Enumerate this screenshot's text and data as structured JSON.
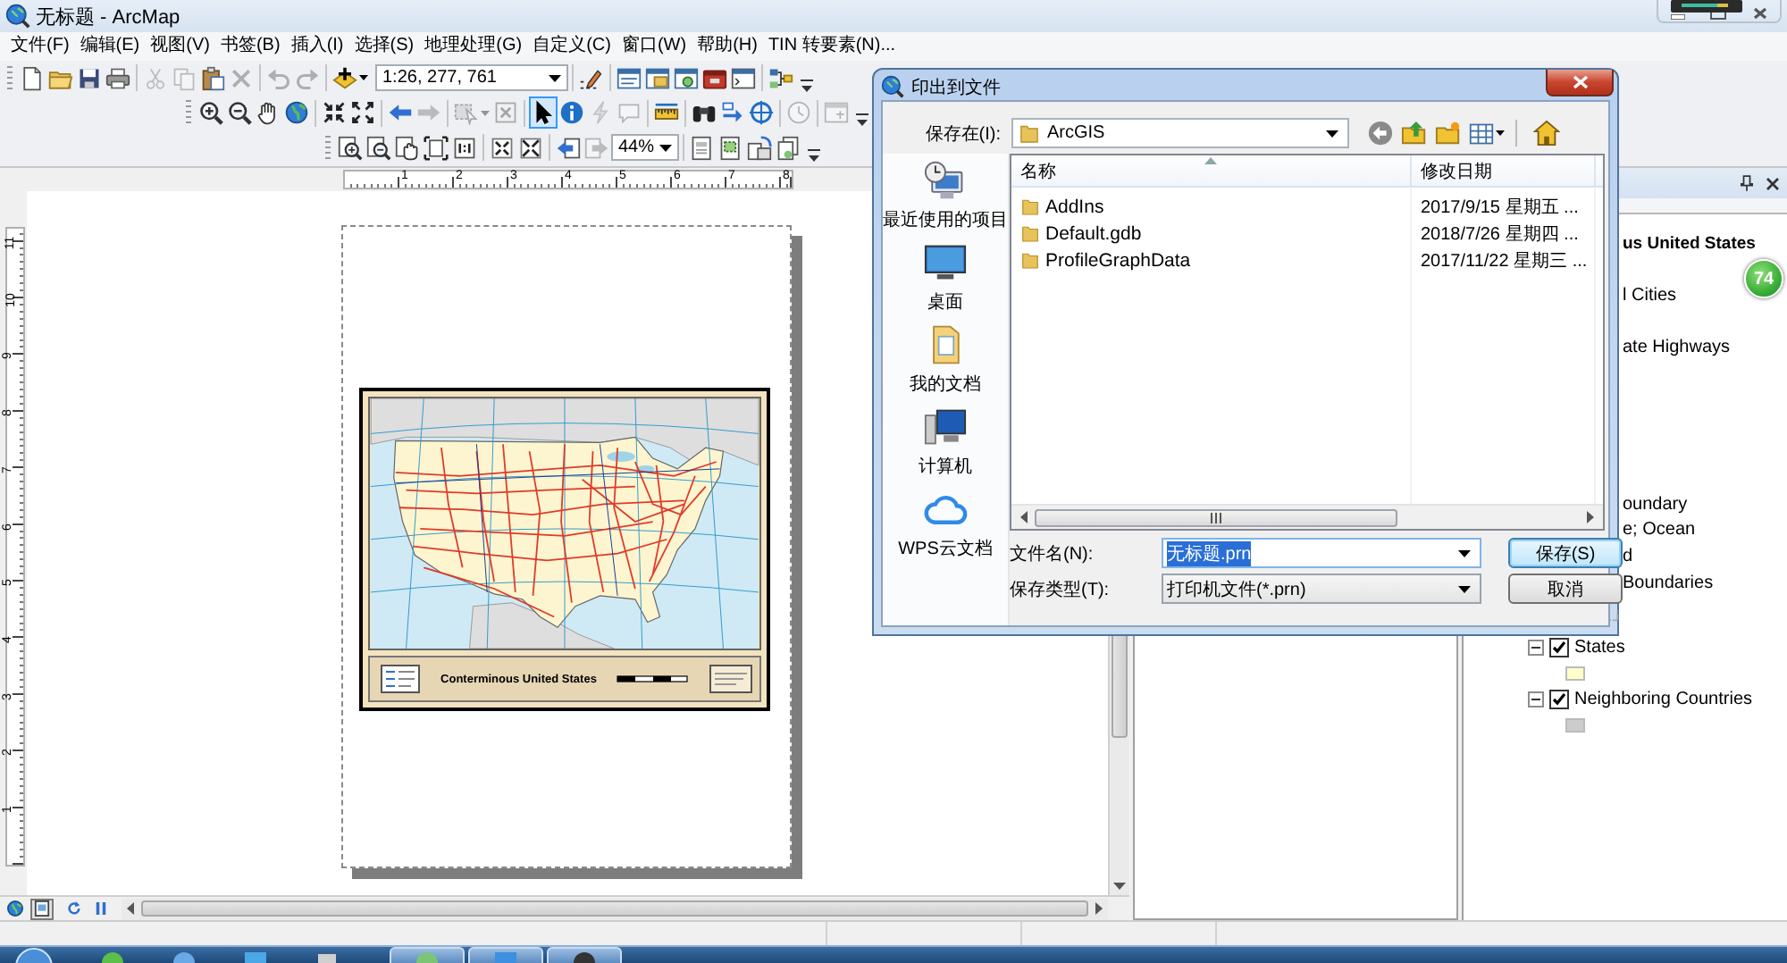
{
  "window": {
    "title": "无标题 - ArcMap"
  },
  "menu": [
    "文件(F)",
    "编辑(E)",
    "视图(V)",
    "书签(B)",
    "插入(I)",
    "选择(S)",
    "地理处理(G)",
    "自定义(C)",
    "窗口(W)",
    "帮助(H)",
    "TIN 转要素(N)..."
  ],
  "toolbars": [
    {
      "items": [
        {
          "kind": "button",
          "disabled": false
        },
        {
          "kind": "button",
          "disabled": false
        },
        {
          "kind": "button",
          "disabled": false
        },
        {
          "kind": "button",
          "disabled": false
        },
        {
          "kind": "separator"
        },
        {
          "kind": "button",
          "disabled": true
        },
        {
          "kind": "button",
          "disabled": true
        },
        {
          "kind": "button",
          "disabled": false
        },
        {
          "kind": "button",
          "disabled": true
        },
        {
          "kind": "separator"
        },
        {
          "kind": "button",
          "disabled": true
        },
        {
          "kind": "button",
          "disabled": true
        },
        {
          "kind": "separator"
        },
        {
          "kind": "dropdown",
          "disabled": false
        },
        {
          "kind": "combo",
          "value": "1:26, 277, 761"
        },
        {
          "kind": "separator"
        },
        {
          "kind": "button",
          "disabled": false
        },
        {
          "kind": "separator"
        },
        {
          "kind": "button",
          "disabled": false
        },
        {
          "kind": "button",
          "disabled": false
        },
        {
          "kind": "button",
          "disabled": false
        },
        {
          "kind": "button",
          "disabled": false
        },
        {
          "kind": "button",
          "disabled": false
        },
        {
          "kind": "separator"
        },
        {
          "kind": "button",
          "disabled": false
        },
        {
          "kind": "overflow"
        }
      ]
    },
    {
      "items": [
        {
          "kind": "tool",
          "disabled": false,
          "selected": false
        },
        {
          "kind": "tool",
          "disabled": false,
          "selected": false
        },
        {
          "kind": "tool",
          "disabled": false,
          "selected": false
        },
        {
          "kind": "button",
          "disabled": false
        },
        {
          "kind": "separator"
        },
        {
          "kind": "button",
          "disabled": false
        },
        {
          "kind": "button",
          "disabled": false
        },
        {
          "kind": "separator"
        },
        {
          "kind": "button",
          "disabled": false
        },
        {
          "kind": "button",
          "disabled": true
        },
        {
          "kind": "separator"
        },
        {
          "kind": "dropdown",
          "disabled": true
        },
        {
          "kind": "button",
          "disabled": true
        },
        {
          "kind": "separator"
        },
        {
          "kind": "tool",
          "disabled": false,
          "selected": true
        },
        {
          "kind": "tool",
          "disabled": false,
          "selected": false
        },
        {
          "kind": "tool",
          "disabled": true,
          "selected": false
        },
        {
          "kind": "tool",
          "disabled": true,
          "selected": false
        },
        {
          "kind": "separator"
        },
        {
          "kind": "tool",
          "disabled": false,
          "selected": false
        },
        {
          "kind": "separator"
        },
        {
          "kind": "button",
          "disabled": false
        },
        {
          "kind": "button",
          "disabled": false
        },
        {
          "kind": "button",
          "disabled": false
        },
        {
          "kind": "separator"
        },
        {
          "kind": "button",
          "disabled": true
        },
        {
          "kind": "separator"
        },
        {
          "kind": "button",
          "disabled": true
        },
        {
          "kind": "overflow"
        }
      ]
    },
    {
      "items": [
        {
          "kind": "tool",
          "disabled": false,
          "selected": false
        },
        {
          "kind": "tool",
          "disabled": false,
          "selected": false
        },
        {
          "kind": "tool",
          "disabled": false,
          "selected": false
        },
        {
          "kind": "button",
          "disabled": false
        },
        {
          "kind": "button",
          "disabled": false
        },
        {
          "kind": "separator"
        },
        {
          "kind": "button",
          "disabled": false
        },
        {
          "kind": "button",
          "disabled": false
        },
        {
          "kind": "separator"
        },
        {
          "kind": "button",
          "disabled": false
        },
        {
          "kind": "button",
          "disabled": true
        },
        {
          "kind": "combo",
          "value": "44%"
        },
        {
          "kind": "separator"
        },
        {
          "kind": "button",
          "disabled": false
        },
        {
          "kind": "button",
          "disabled": false
        },
        {
          "kind": "button",
          "disabled": false
        },
        {
          "kind": "button",
          "disabled": false
        },
        {
          "kind": "overflow"
        }
      ]
    }
  ],
  "layout_view": {
    "h_ruler": [
      "1",
      "2",
      "3",
      "4",
      "5",
      "6",
      "7",
      "8"
    ],
    "v_ruler": [
      "11",
      "10",
      "9",
      "8",
      "7",
      "6",
      "5",
      "4",
      "3",
      "2",
      "1"
    ],
    "map_title": "Conterminous United States",
    "view_buttons": [
      {
        "selected": false
      },
      {
        "selected": true
      }
    ]
  },
  "toc": {
    "items": [
      {
        "kind": "data-frame",
        "label": "us United States"
      },
      {
        "kind": "layer",
        "label": "l Cities"
      },
      {
        "kind": "layer",
        "label": "ate Highways"
      },
      {
        "kind": "layer",
        "label": "oundary"
      },
      {
        "kind": "layer",
        "label": "e; Ocean"
      },
      {
        "kind": "layer",
        "label": "d"
      },
      {
        "kind": "layer",
        "label": "Boundaries"
      },
      {
        "kind": "layer",
        "label": "States",
        "expanded": true,
        "checked": true,
        "color": "#ffffcc"
      },
      {
        "kind": "layer",
        "label": "Neighboring Countries",
        "expanded": true,
        "checked": true,
        "color": "#cccccc"
      }
    ]
  },
  "floating_ball": {
    "label": "74"
  },
  "dialog": {
    "title": "印出到文件",
    "save_in": {
      "label": "保存在(I):",
      "value": "ArcGIS"
    },
    "places": [
      {
        "label": "最近使用的项目"
      },
      {
        "label": "桌面"
      },
      {
        "label": "我的文档"
      },
      {
        "label": "计算机"
      },
      {
        "label": "WPS云文档"
      }
    ],
    "columns": [
      "名称",
      "修改日期"
    ],
    "files": [
      {
        "name": "AddIns",
        "modified": "2017/9/15 星期五 ...",
        "selected": false
      },
      {
        "name": "Default.gdb",
        "modified": "2018/7/26 星期四 ...",
        "selected": false
      },
      {
        "name": "ProfileGraphData",
        "modified": "2017/11/22 星期三 ...",
        "selected": false
      }
    ],
    "file_name": {
      "label": "文件名(N):",
      "value": "无标题.prn",
      "value_selected": true
    },
    "file_type": {
      "label": "保存类型(T):",
      "value": "打印机文件(*.prn)"
    },
    "buttons": [
      {
        "label": "保存(S)",
        "default": true
      },
      {
        "label": "取消",
        "default": false
      }
    ]
  }
}
